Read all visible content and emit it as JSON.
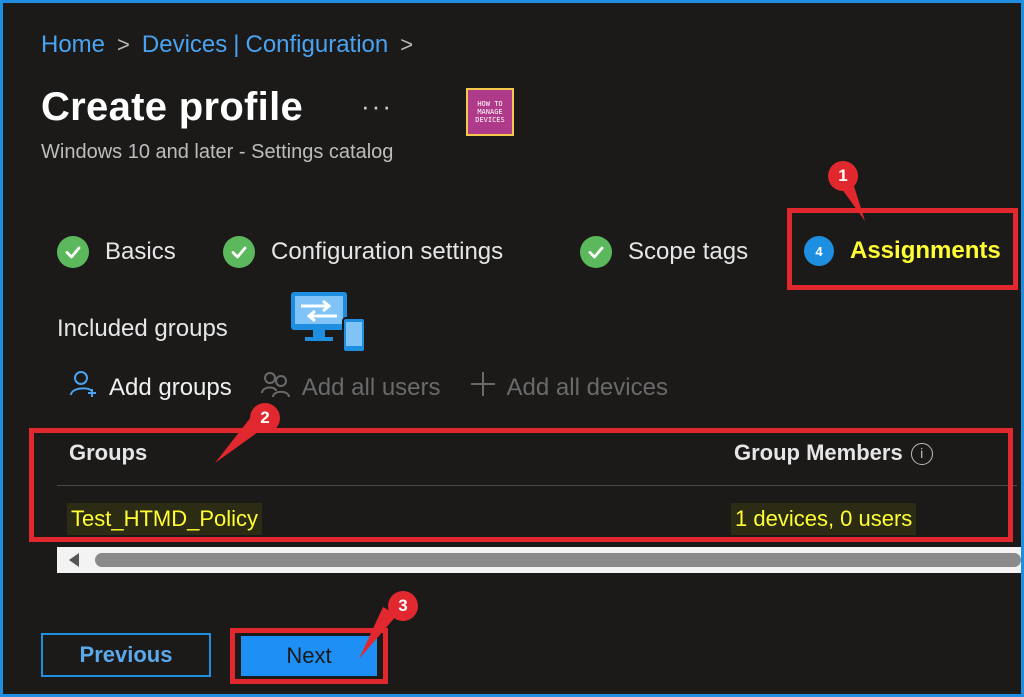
{
  "breadcrumb": {
    "home": "Home",
    "devices": "Devices",
    "pipe": "|",
    "configuration": "Configuration",
    "separator": ">"
  },
  "header": {
    "title": "Create profile",
    "more": "···",
    "subtitle": "Windows 10 and later - Settings catalog",
    "logo_lines": [
      "HOW TO",
      "MANAGE",
      "DEVICES"
    ]
  },
  "steps": [
    {
      "label": "Basics",
      "status": "complete"
    },
    {
      "label": "Configuration settings",
      "status": "complete"
    },
    {
      "label": "Scope tags",
      "status": "complete"
    },
    {
      "label": "Assignments",
      "status": "current",
      "number": "4"
    }
  ],
  "section": {
    "included_label": "Included groups"
  },
  "commands": {
    "add_groups": "Add groups",
    "add_all_users": "Add all users",
    "add_all_devices": "Add all devices"
  },
  "table": {
    "headers": {
      "groups": "Groups",
      "members": "Group Members"
    },
    "info_glyph": "i",
    "rows": [
      {
        "group": "Test_HTMD_Policy",
        "members": "1 devices, 0 users"
      }
    ]
  },
  "footer": {
    "previous": "Previous",
    "next": "Next"
  },
  "callouts": [
    "1",
    "2",
    "3"
  ],
  "colors": {
    "accent": "#1e8fe0",
    "highlight": "#ffff33",
    "annotation": "#e0282e",
    "check": "#5cb85c"
  }
}
